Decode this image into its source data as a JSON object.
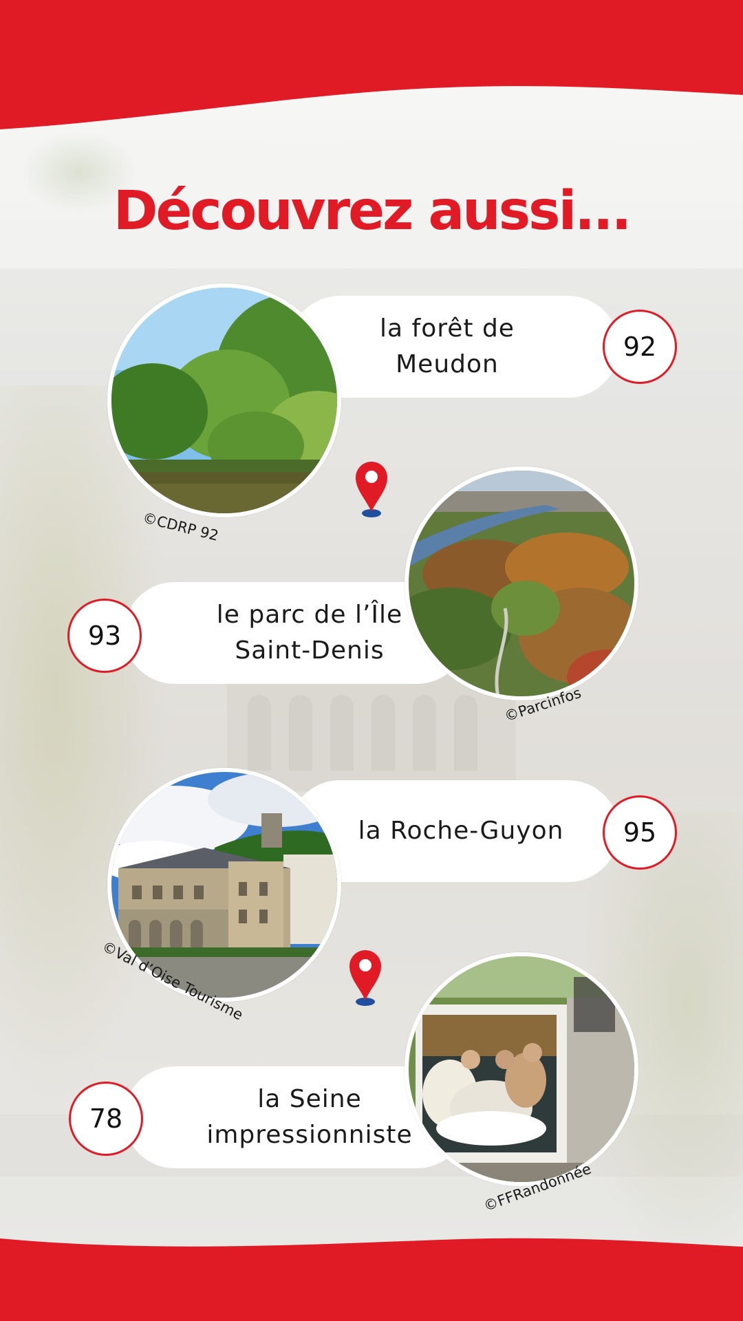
{
  "title": "Découvrez aussi...",
  "colors": {
    "accent_red": "#e01b26",
    "pin_blue": "#1f4f9e"
  },
  "places": [
    {
      "name": "la forêt de Meudon",
      "lines": [
        "la forêt de",
        "Meudon"
      ],
      "department": "92",
      "credit": "©CDRP 92",
      "photo": "forest-lake"
    },
    {
      "name": "le parc de l’Île Saint-Denis",
      "lines": [
        "le parc de l’Île",
        "Saint-Denis"
      ],
      "department": "93",
      "credit": "©Parcinfos",
      "photo": "aerial-park"
    },
    {
      "name": "la Roche-Guyon",
      "lines": [
        "la Roche-Guyon"
      ],
      "department": "95",
      "credit": "©Val d’Oise Tourisme",
      "photo": "chateau"
    },
    {
      "name": "la Seine impressionniste",
      "lines": [
        "la Seine",
        "impressionniste"
      ],
      "department": "78",
      "credit": "©FFRandonnée",
      "photo": "painting-panel"
    }
  ],
  "icons": [
    "map-pin-icon",
    "map-pin-icon"
  ]
}
